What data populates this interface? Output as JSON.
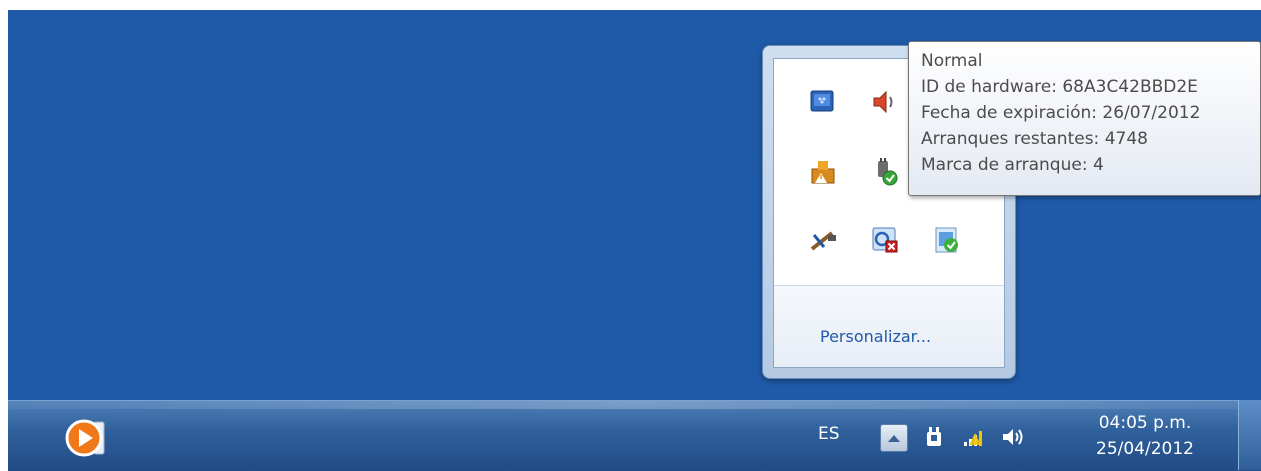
{
  "taskbar": {
    "pinned_app_icon": "media-player-icon",
    "language": "ES",
    "show_hidden_icon": "chevron-up-icon",
    "tray_icons": [
      "power-plug-icon",
      "network-signal-icon",
      "speaker-icon"
    ],
    "clock_time": "04:05 p.m.",
    "clock_date": "25/04/2012"
  },
  "overflow_popup": {
    "icons": [
      "blackberry-icon",
      "speaker-icon",
      "network-share-icon",
      "warning-drive-icon",
      "usb-plug-check-icon",
      "hidden-icon",
      "connection-tools-icon",
      "sync-error-icon",
      "activation-check-icon"
    ],
    "customize_link": "Personalizar..."
  },
  "tooltip": {
    "lines": [
      "Normal",
      "ID de hardware: 68A3C42BBD2E",
      "Fecha de expiración: 26/07/2012",
      "Arranques restantes: 4748",
      "Marca de arranque: 4"
    ]
  }
}
